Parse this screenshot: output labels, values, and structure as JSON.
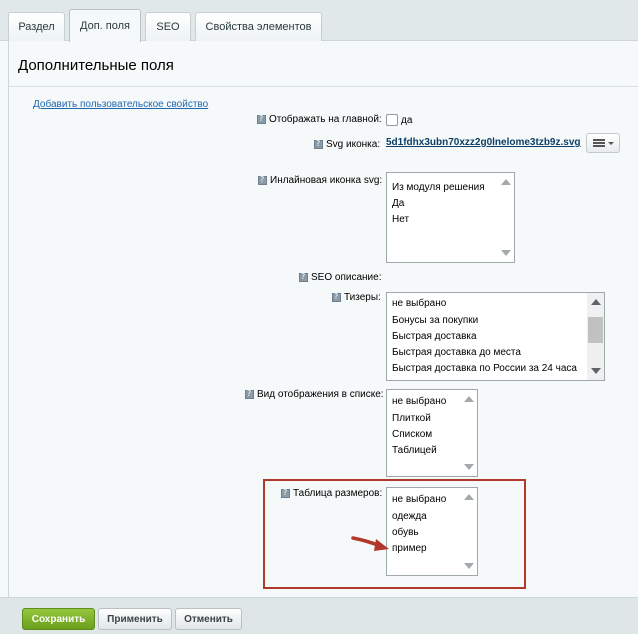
{
  "tabs": [
    {
      "label": "Раздел",
      "active": false
    },
    {
      "label": "Доп. поля",
      "active": true
    },
    {
      "label": "SEO",
      "active": false
    },
    {
      "label": "Свойства элементов",
      "active": false
    }
  ],
  "section": {
    "title": "Дополнительные поля",
    "add_link": "Добавить пользовательское свойство"
  },
  "fields": {
    "show_main": {
      "label": "Отображать на главной:",
      "checkbox_text": "да"
    },
    "svg_icon": {
      "label": "Svg иконка:",
      "file": "5d1fdhx3ubn70xzz2g0lnelome3tzb9z.svg"
    },
    "inline_svg": {
      "label": "Инлайновая иконка svg:",
      "options": [
        "Из модуля решения",
        "Да",
        "Нет"
      ]
    },
    "seo_desc": {
      "label": "SEO описание:"
    },
    "teasers": {
      "label": "Тизеры:",
      "options": [
        "не выбрано",
        "Бонусы за покупки",
        "Быстрая доставка",
        "Быстрая доставка до места",
        "Быстрая доставка по России за 24 часа"
      ]
    },
    "list_view": {
      "label": "Вид отображения в списке:",
      "options": [
        "не выбрано",
        "Плиткой",
        "Списком",
        "Таблицей"
      ]
    },
    "size_table": {
      "label": "Таблица размеров:",
      "options": [
        "не выбрано",
        "одежда",
        "обувь",
        "пример"
      ]
    }
  },
  "footer": {
    "save": "Сохранить",
    "apply": "Применить",
    "cancel": "Отменить"
  },
  "colors": {
    "highlight": "#b0392c",
    "primary_button": "#7cb22a",
    "link": "#2067b0"
  },
  "icons": [
    "hint-icon",
    "menu-icon",
    "arrow-annotation-icon"
  ]
}
